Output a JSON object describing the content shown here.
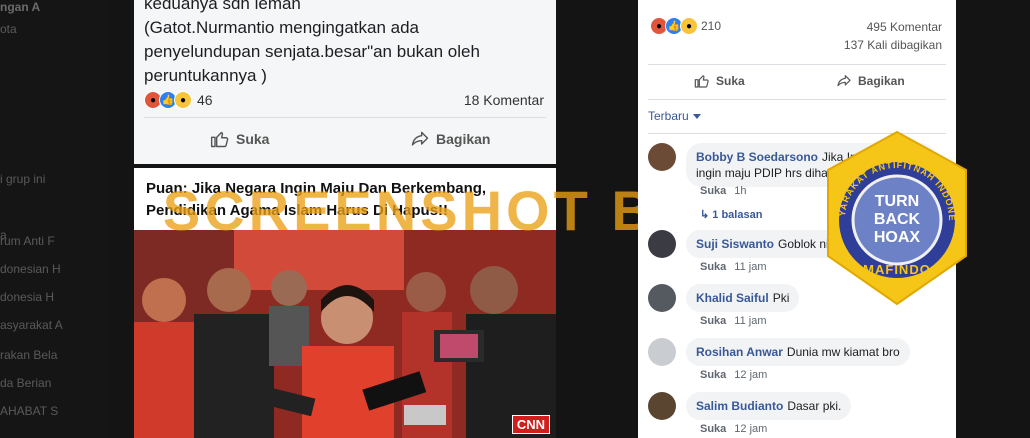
{
  "sidebar": {
    "items": [
      {
        "label": "ngan A",
        "bold": true
      },
      {
        "label": "ota",
        "bold": false
      },
      {
        "label": "",
        "bold": false
      },
      {
        "label": "",
        "bold": false
      },
      {
        "label": "",
        "bold": false
      },
      {
        "label": "i grup ini",
        "bold": false
      },
      {
        "label": "",
        "bold": false
      },
      {
        "label": "a",
        "bold": false
      },
      {
        "label": "rum Anti F",
        "bold": false
      },
      {
        "label": "donesian H",
        "bold": false
      },
      {
        "label": "donesia H",
        "bold": false
      },
      {
        "label": "asyarakat A",
        "bold": false
      },
      {
        "label": "rakan Bela",
        "bold": false
      },
      {
        "label": "da Berian",
        "bold": false
      },
      {
        "label": "AHABAT S",
        "bold": false
      }
    ]
  },
  "post": {
    "text_lines": [
      "keduanya sdh leman",
      "(Gatot.Nurmantio mengingatkan ada",
      "penyelundupan senjata.besar\"an bukan oleh",
      "peruntukannya )"
    ],
    "reactions": [
      "angry",
      "like",
      "wow"
    ],
    "reaction_count": "46",
    "comment_count": "18 Komentar",
    "like_label": "Suka",
    "share_label": "Bagikan"
  },
  "photo": {
    "caption_line1": "Puan: Jika Negara Ingin Maju Dan Berkembang,",
    "caption_line2": "Pendidikan Agama Islam Harus Di Hapus!!",
    "logo": "CNN"
  },
  "watermark": "SCREENSHOT BY",
  "right_panel": {
    "reactions": [
      "angry",
      "like",
      "wow"
    ],
    "reaction_count": "210",
    "comment_count": "495 Komentar",
    "share_count": "137 Kali dibagikan",
    "like_label": "Suka",
    "share_label": "Bagikan",
    "sort_label": "Terbaru",
    "comments": [
      {
        "name": "Bobby B Soedarsono",
        "text": "Jika Indonesia ingin maju PDIP hrs dihapus.",
        "like": "Suka",
        "time": "1h",
        "reply_count": "1 balasan",
        "reaction_count": "5",
        "avatar_color": "#6b4a36"
      },
      {
        "name": "Suji Siswanto",
        "text": "Goblok ni orang.",
        "like": "Suka",
        "time": "11 jam",
        "avatar_color": "#3b3b44"
      },
      {
        "name": "Khalid Saiful",
        "text": "Pki",
        "like": "Suka",
        "time": "11 jam",
        "avatar_color": "#555960"
      },
      {
        "name": "Rosihan Anwar",
        "text": "Dunia mw kiamat bro",
        "like": "Suka",
        "time": "12 jam",
        "avatar_color": "#c9ccd1"
      },
      {
        "name": "Salim Budianto",
        "text": "Dasar pki.",
        "like": "Suka",
        "time": "12 jam",
        "avatar_color": "#5a4630"
      }
    ]
  },
  "badge": {
    "line1": "TURN",
    "line2": "BACK",
    "line3": "HOAX",
    "ring_text": "MASYARAKAT ANTIFITNAH INDONESIA",
    "bottom_text": "MAFINDO",
    "colors": {
      "gold": "#f5c518",
      "blue": "#2f3e99",
      "inner": "#6d82c6"
    }
  }
}
